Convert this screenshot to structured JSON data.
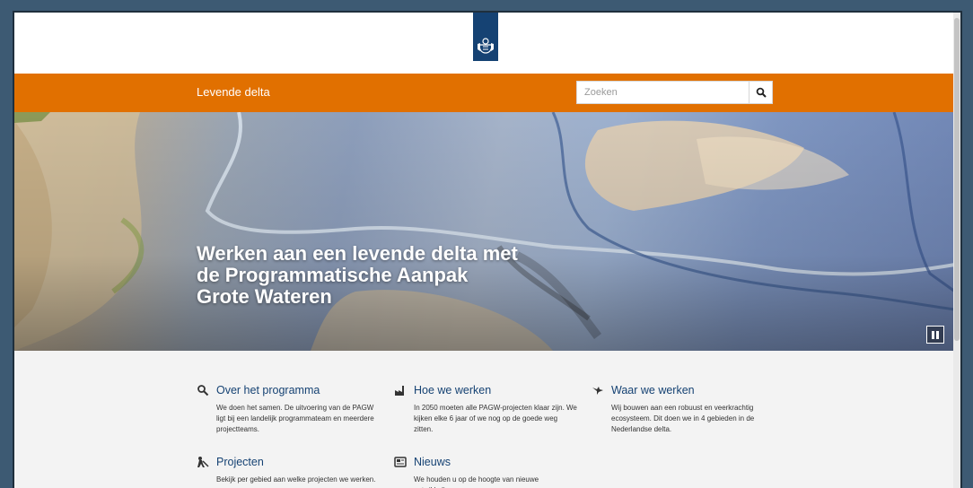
{
  "header": {
    "site_title": "Levende delta",
    "search": {
      "placeholder": "Zoeken"
    }
  },
  "hero": {
    "title_lines": [
      "Werken aan een levende delta met",
      "de Programmatische Aanpak",
      "Grote Wateren"
    ]
  },
  "cards": [
    {
      "icon": "magnifier-icon",
      "title": "Over het programma",
      "desc": "We doen het samen. De uitvoering van de PAGW ligt bij een landelijk programmateam en meerdere projectteams."
    },
    {
      "icon": "factory-icon",
      "title": "Hoe we werken",
      "desc": "In 2050 moeten alle PAGW-projecten klaar zijn. We kijken elke 6 jaar of we nog op de goede weg zitten."
    },
    {
      "icon": "bird-icon",
      "title": "Waar we werken",
      "desc": "Wij bouwen aan een robuust en veerkrachtig ecosysteem. Dit doen we in 4 gebieden in de Nederlandse delta."
    },
    {
      "icon": "worker-icon",
      "title": "Projecten",
      "desc": "Bekijk per gebied aan welke projecten we werken."
    },
    {
      "icon": "news-icon",
      "title": "Nieuws",
      "desc": "We houden u op de hoogte van nieuwe ontwikkelingen."
    }
  ],
  "colors": {
    "brand_orange": "#e17000",
    "brand_blue": "#154273"
  }
}
